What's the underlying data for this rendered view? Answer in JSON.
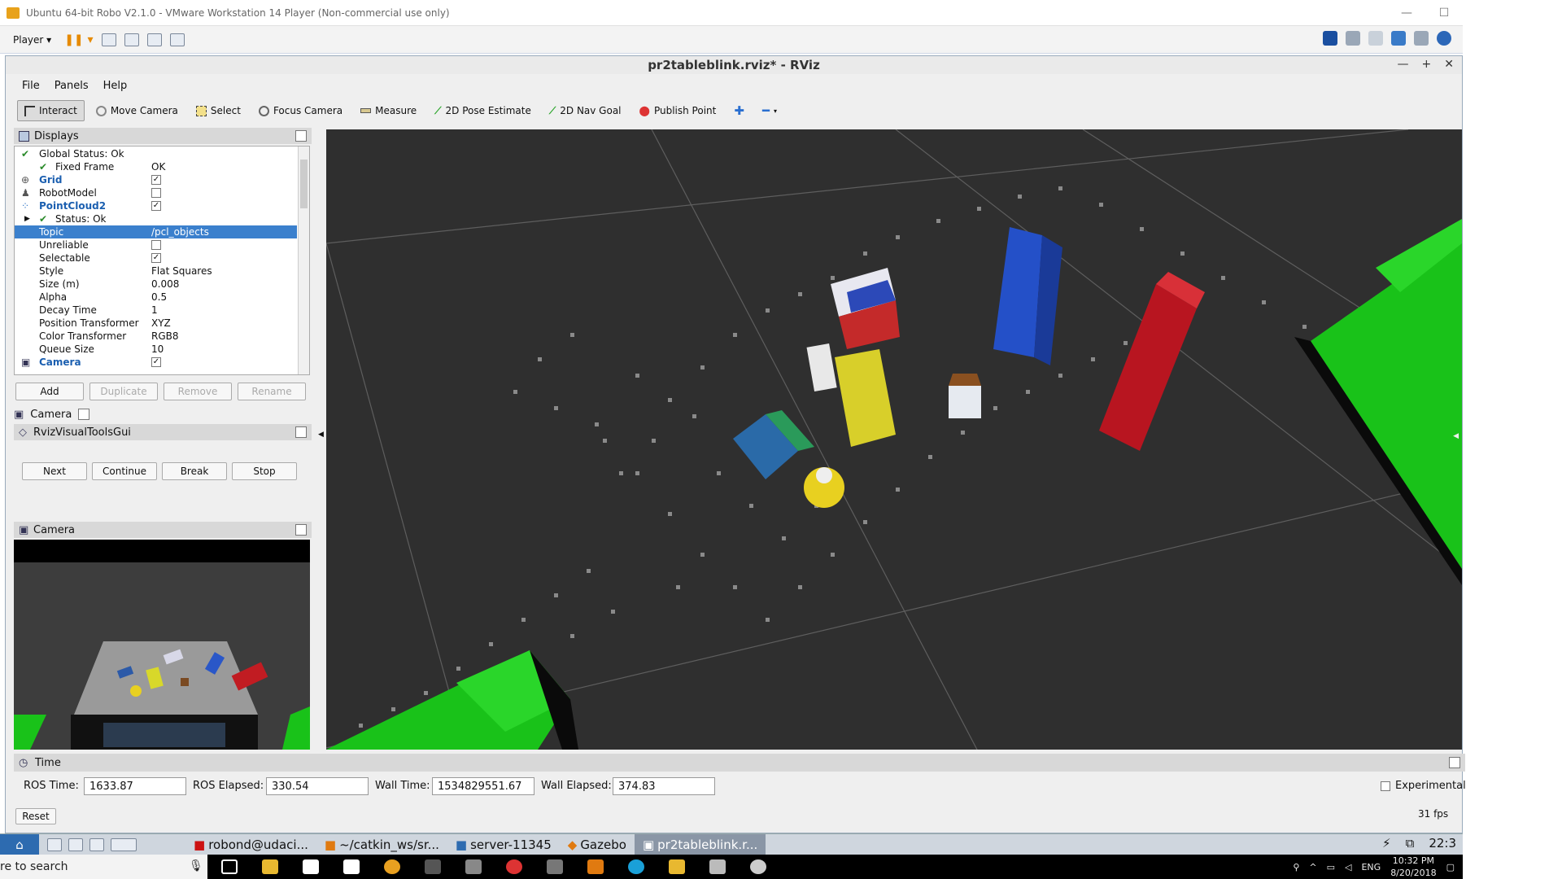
{
  "vm_window": {
    "title": "Ubuntu 64-bit Robo V2.1.0 - VMware Workstation 14 Player (Non-commercial use only)",
    "player_label": "Player",
    "minimize": "—",
    "maximize": "☐"
  },
  "rviz": {
    "title": "pr2tableblink.rviz* - RViz",
    "win_min": "—",
    "win_max": "+",
    "win_close": "✕"
  },
  "menu": {
    "file": "File",
    "panels": "Panels",
    "help": "Help"
  },
  "toolbar": {
    "interact": "Interact",
    "move_camera": "Move Camera",
    "select": "Select",
    "focus_camera": "Focus Camera",
    "measure": "Measure",
    "pose_estimate": "2D Pose Estimate",
    "nav_goal": "2D Nav Goal",
    "publish_point": "Publish Point"
  },
  "displays": {
    "title": "Displays",
    "global_status": "Global Status: Ok",
    "fixed_frame_label": "Fixed Frame",
    "fixed_frame_value": "OK",
    "grid": "Grid",
    "robot_model": "RobotModel",
    "pointcloud2": "PointCloud2",
    "status_ok": "Status: Ok",
    "topic_label": "Topic",
    "topic_value": "/pcl_objects",
    "unreliable": "Unreliable",
    "selectable": "Selectable",
    "style_label": "Style",
    "style_value": "Flat Squares",
    "size_label": "Size (m)",
    "size_value": "0.008",
    "alpha_label": "Alpha",
    "alpha_value": "0.5",
    "decay_label": "Decay Time",
    "decay_value": "1",
    "pos_tf_label": "Position Transformer",
    "pos_tf_value": "XYZ",
    "color_tf_label": "Color Transformer",
    "color_tf_value": "RGB8",
    "queue_label": "Queue Size",
    "queue_value": "10",
    "camera": "Camera"
  },
  "display_buttons": {
    "add": "Add",
    "duplicate": "Duplicate",
    "remove": "Remove",
    "rename": "Rename"
  },
  "camera_tool": "Camera",
  "visual_tools": {
    "title": "RvizVisualToolsGui",
    "next": "Next",
    "continue": "Continue",
    "break": "Break",
    "stop": "Stop"
  },
  "camera_panel": {
    "title": "Camera"
  },
  "time": {
    "title": "Time",
    "ros_time_label": "ROS Time:",
    "ros_time": "1633.87",
    "ros_elapsed_label": "ROS Elapsed:",
    "ros_elapsed": "330.54",
    "wall_time_label": "Wall Time:",
    "wall_time": "1534829551.67",
    "wall_elapsed_label": "Wall Elapsed:",
    "wall_elapsed": "374.83",
    "experimental": "Experimental",
    "reset": "Reset",
    "fps": "31 fps"
  },
  "guest_taskbar": {
    "terminal": "robond@udaci...",
    "editor": "~/catkin_ws/sr...",
    "server": "server-11345",
    "gazebo": "Gazebo",
    "rviz": "pr2tableblink.r...",
    "clock": "22:3"
  },
  "windows": {
    "search": "re to search",
    "lang": "ENG",
    "time": "10:32 PM",
    "date": "8/20/2018"
  },
  "colors": {
    "selection": "#3b80cd",
    "viewport_bg": "#2f2f2f",
    "green": "#19c219",
    "toolbar_bg": "#efefef"
  }
}
